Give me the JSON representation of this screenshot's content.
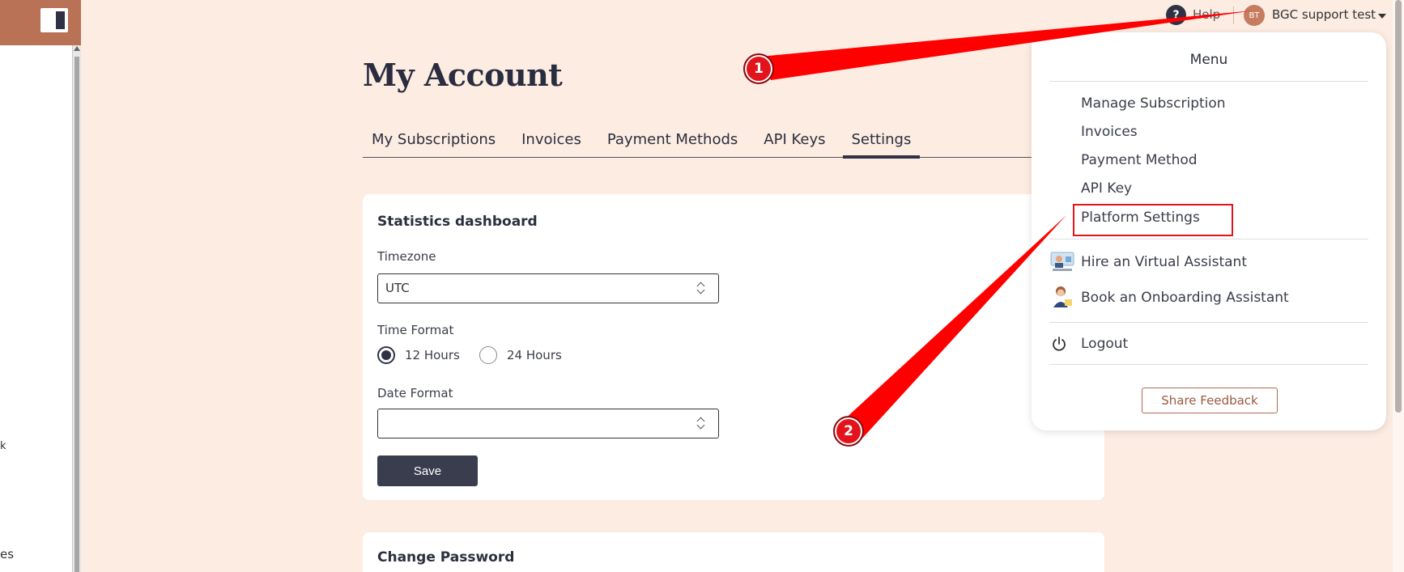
{
  "sidebar": {
    "peek_text": "es",
    "peek_text2": "k"
  },
  "page": {
    "title": "My Account"
  },
  "tabs": [
    {
      "label": "My Subscriptions"
    },
    {
      "label": "Invoices"
    },
    {
      "label": "Payment Methods"
    },
    {
      "label": "API Keys"
    },
    {
      "label": "Settings",
      "active": true
    }
  ],
  "stats_card": {
    "title": "Statistics dashboard",
    "timezone_label": "Timezone",
    "timezone_value": "UTC",
    "time_format_label": "Time Format",
    "time_format_options": [
      "12 Hours",
      "24 Hours"
    ],
    "time_format_selected": "12 Hours",
    "date_format_label": "Date Format",
    "date_format_value": "",
    "save_label": "Save"
  },
  "password_card": {
    "title": "Change Password"
  },
  "header": {
    "help_icon": "?",
    "help_label": "Help",
    "avatar_initials": "BT",
    "user_name": "BGC support test"
  },
  "menu": {
    "title": "Menu",
    "items": [
      "Manage Subscription",
      "Invoices",
      "Payment Method",
      "API Key",
      "Platform Settings"
    ],
    "assistant_items": [
      "Hire an Virtual Assistant",
      "Book an Onboarding Assistant"
    ],
    "logout_label": "Logout",
    "feedback_label": "Share Feedback"
  },
  "annotations": {
    "step1": "1",
    "step2": "2"
  },
  "colors": {
    "accent": "#2f3244",
    "brand": "#b97256",
    "annotation": "#e3131c",
    "page_bg": "#fcece2"
  }
}
